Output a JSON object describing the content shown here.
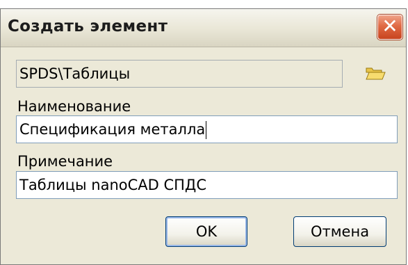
{
  "dialog": {
    "title": "Создать элемент",
    "path_value": "SPDS\\Таблицы",
    "name_label": "Наименование",
    "name_value": "Спецификация металла",
    "note_label": "Примечание",
    "note_value": "Таблицы nanoCAD СПДС",
    "ok_label": "OK",
    "cancel_label": "Отмена",
    "close_glyph": "✕"
  },
  "icons": {
    "close": "close-icon",
    "browse": "folder-open-icon"
  },
  "colors": {
    "window_bg": "#ece9d8",
    "close_button": "#e06a45",
    "field_border": "#7f9db9",
    "button_border": "#003c74"
  }
}
